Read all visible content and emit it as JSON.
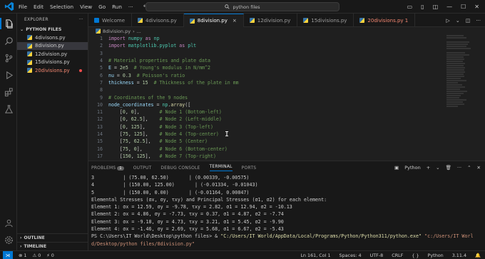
{
  "titlebar": {
    "menu": [
      "File",
      "Edit",
      "Selection",
      "View",
      "Go",
      "Run"
    ],
    "more": "···",
    "search_text": "python files"
  },
  "sidebar": {
    "title": "EXPLORER",
    "more": "···",
    "folder": "PYTHON FILES",
    "files": [
      {
        "name": "4divisons.py",
        "state": "normal"
      },
      {
        "name": "8division.py",
        "state": "selected"
      },
      {
        "name": "12division.py",
        "state": "normal"
      },
      {
        "name": "15divisions.py",
        "state": "normal"
      },
      {
        "name": "20divisions.py",
        "state": "error"
      }
    ],
    "outline": "OUTLINE",
    "timeline": "TIMELINE"
  },
  "tabs": [
    {
      "label": "Welcome",
      "icon": "vscode-icon",
      "active": false,
      "error": false
    },
    {
      "label": "4divisons.py",
      "icon": "python-icon",
      "active": false,
      "error": false
    },
    {
      "label": "8division.py",
      "icon": "python-icon",
      "active": true,
      "error": false,
      "close": "×"
    },
    {
      "label": "12division.py",
      "icon": "python-icon",
      "active": false,
      "error": false
    },
    {
      "label": "15divisions.py",
      "icon": "python-icon",
      "active": false,
      "error": false
    },
    {
      "label": "20divisions.py 1",
      "icon": "python-icon",
      "active": false,
      "error": true
    }
  ],
  "breadcrumb": {
    "file": "8division.py",
    "symbol": "..."
  },
  "code": [
    {
      "n": "1",
      "html": "<span class='kw'>import</span> <span class='mod'>numpy</span> <span class='kw'>as</span> <span class='mod'>np</span>"
    },
    {
      "n": "2",
      "html": "<span class='kw'>import</span> <span class='mod'>matplotlib.pyplot</span> <span class='kw'>as</span> <span class='mod'>plt</span>"
    },
    {
      "n": "3",
      "html": ""
    },
    {
      "n": "4",
      "html": "<span class='cm'># Material properties and plate data</span>"
    },
    {
      "n": "5",
      "html": "<span class='var'>E</span> = <span class='num'>2e5</span>  <span class='cm'># Young's modulus in N/mm^2</span>"
    },
    {
      "n": "6",
      "html": "<span class='var'>nu</span> = <span class='num'>0.3</span>  <span class='cm'># Poisson's ratio</span>"
    },
    {
      "n": "7",
      "html": "<span class='var'>thickness</span> = <span class='num'>15</span>  <span class='cm'># Thickness of the plate in mm</span>"
    },
    {
      "n": "8",
      "html": ""
    },
    {
      "n": "9",
      "html": "<span class='cm'># Coordinates of the 9 nodes</span>"
    },
    {
      "n": "10",
      "html": "<span class='var'>node_coordinates</span> = <span class='mod'>np</span>.<span class='fn'>array</span>(["
    },
    {
      "n": "11",
      "html": "    [<span class='num'>0</span>, <span class='num'>0</span>],       <span class='cm'># Node 1 (Bottom-left)</span>"
    },
    {
      "n": "12",
      "html": "    [<span class='num'>0</span>, <span class='num'>62.5</span>],    <span class='cm'># Node 2 (Left-middle)</span>"
    },
    {
      "n": "13",
      "html": "    [<span class='num'>0</span>, <span class='num'>125</span>],     <span class='cm'># Node 3 (Top-left)</span>"
    },
    {
      "n": "14",
      "html": "    [<span class='num'>75</span>, <span class='num'>125</span>],    <span class='cm'># Node 4 (Top-center)</span>"
    },
    {
      "n": "15",
      "html": "    [<span class='num'>75</span>, <span class='num'>62.5</span>],   <span class='cm'># Node 5 (Center)</span>"
    },
    {
      "n": "16",
      "html": "    [<span class='num'>75</span>, <span class='num'>0</span>],      <span class='cm'># Node 6 (Bottom-center)</span>"
    },
    {
      "n": "17",
      "html": "    [<span class='num'>150</span>, <span class='num'>125</span>],   <span class='cm'># Node 7 (Top-right)</span>"
    }
  ],
  "panel": {
    "tabs": [
      "PROBLEMS",
      "OUTPUT",
      "DEBUG CONSOLE",
      "TERMINAL",
      "PORTS"
    ],
    "problems_badge": "1",
    "active_tab": "TERMINAL",
    "shell": "Python",
    "terminal_lines": [
      "3          | (75.00, 62.50)       | (0.00339, -0.00575)",
      "4          | (150.00, 125.00)       | (-0.01334, -0.01043)",
      "5          | (150.00, 0.00)       | (-0.01164, 0.00847)",
      "Elemental Stresses (σx, σy, τxy) and Principal Stresses (σ1, σ2) for each element:",
      "Element 1: σx = 12.59, σy = -9.78, τxy = 2.82, σ1 = 12.94, σ2 = -10.13",
      "Element 2: σx = 4.86, σy = -7.73, τxy = 0.37, σ1 = 4.87, σ2 = -7.74",
      "Element 3: σx = -9.18, σy = 4.73, τxy = 3.21, σ1 = 5.45, σ2 = -9.90",
      "Element 4: σx = -1.46, σy = 2.69, τxy = 5.68, σ1 = 6.67, σ2 = -5.43"
    ],
    "prompt": "PS C:\\Users\\IT World\\Desktop\\python files> ",
    "cmd_amp": "& ",
    "cmd_exe": "\"C:/Users/IT World/AppData/Local/Programs/Python/Python311/python.exe\"",
    "cmd_arg": " \"c:/Users/IT Worl",
    "cmd_arg2": "d/Desktop/python files/8division.py\""
  },
  "statusbar": {
    "errors": "⊗ 1",
    "warnings": "⚠ 0",
    "ports": "⚡ 0",
    "position": "Ln 161, Col 1",
    "spaces": "Spaces: 4",
    "encoding": "UTF-8",
    "eol": "CRLF",
    "braces": "{ }",
    "language": "Python",
    "version": "3.11.4"
  },
  "colors": {
    "accent": "#0078d4",
    "error": "#f48771"
  }
}
